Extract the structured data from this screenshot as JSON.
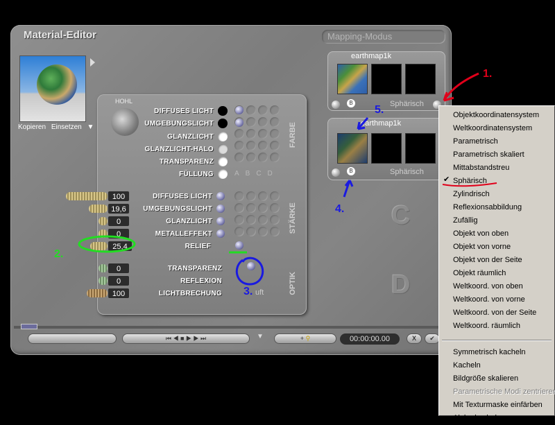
{
  "window": {
    "title": "Material-Editor",
    "mode_field": "Mapping-Modus"
  },
  "preview": {
    "copy_label": "Kopieren",
    "paste_label": "Einsetzen"
  },
  "material": {
    "hohl_label": "HOHL",
    "color_rows": [
      {
        "label": "DIFFUSES LICHT"
      },
      {
        "label": "UMGEBUNGSLICHT"
      },
      {
        "label": "GLANZLICHT"
      },
      {
        "label": "GLANZLICHT-HALO"
      },
      {
        "label": "TRANSPARENZ"
      },
      {
        "label": "FÜLLUNG"
      }
    ],
    "strength_rows": [
      {
        "value": "100",
        "label": "DIFFUSES LICHT"
      },
      {
        "value": "19,6",
        "label": "UMGEBUNGSLICHT"
      },
      {
        "value": "0",
        "label": "GLANZLICHT"
      },
      {
        "value": "0",
        "label": "METALLEFFEKT"
      },
      {
        "value": "25,4",
        "label": "RELIEF"
      }
    ],
    "optic_rows": [
      {
        "value": "0",
        "label": "TRANSPARENZ"
      },
      {
        "value": "0",
        "label": "REFLEXION"
      },
      {
        "value": "100",
        "label": "LICHTBRECHUNG"
      }
    ],
    "section_farbe": "FARBE",
    "section_staerke": "STÄRKE",
    "section_optik": "OPTIK",
    "columns": "ABCD",
    "luft_label": "uft"
  },
  "mapping": [
    {
      "name": "earthmap1k",
      "mode": "Sphärisch",
      "badge": "B"
    },
    {
      "name": "earthmap1k",
      "mode": "Sphärisch",
      "badge": "B"
    }
  ],
  "slots": {
    "c": "C",
    "d": "D"
  },
  "transport": {
    "timecode": "00:00:00.00",
    "add": "+",
    "close": "X"
  },
  "menu": {
    "items": [
      "Objektkoordinatensystem",
      "Weltkoordinatensystem",
      "Parametrisch",
      "Parametrisch skaliert",
      "Mittabstandstreu",
      "Sphärisch",
      "Zylindrisch",
      "Reflexionsabbildung",
      "Zufällig",
      "Objekt von oben",
      "Objekt von vorne",
      "Objekt von der Seite",
      "Objekt räumlich",
      "Weltkoord. von oben",
      "Weltkoord. von vorne",
      "Weltkoord. von der Seite",
      "Weltkoord. räumlich"
    ],
    "checked_index": 5,
    "items2": [
      "Symmetrisch kacheln",
      "Kacheln",
      "Bildgröße skalieren",
      "Parametrische Modi zentrieren",
      "Mit Texturmaske einfärben",
      "Alpha kacheln"
    ],
    "disabled_items2": [
      3
    ]
  },
  "annotations": {
    "n1": "1.",
    "n2": "2.",
    "n3": "3.",
    "n4": "4.",
    "n5": "5."
  },
  "colors": {
    "red": "#e0001a",
    "blue": "#1a1ae0",
    "green": "#22dd22"
  }
}
